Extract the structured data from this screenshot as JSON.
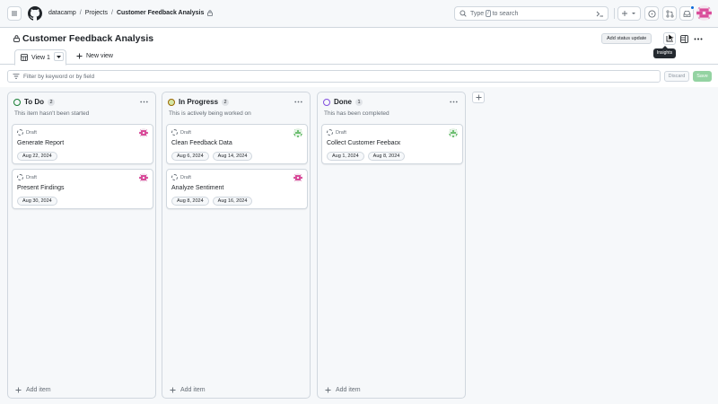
{
  "header": {
    "breadcrumbs": [
      "datacamp",
      "Projects",
      "Customer Feedback Analysis"
    ],
    "search": {
      "pre": "Type",
      "key": "/",
      "post": "to search"
    }
  },
  "project": {
    "title": "Customer Feedback Analysis",
    "status_button": "Add status update",
    "tooltip": "Insights"
  },
  "tabs": {
    "view": "View 1",
    "new_view": "New view"
  },
  "filter": {
    "placeholder": "Filter by keyword or by field",
    "discard": "Discard",
    "save": "Save"
  },
  "columns": [
    {
      "name": "To Do",
      "count": "2",
      "description": "This item hasn't been started",
      "color": "#1a7f37",
      "cards": [
        {
          "status": "Draft",
          "title": "Generate Report",
          "dates": [
            "Aug 22, 2024"
          ]
        },
        {
          "status": "Draft",
          "title": "Present Findings",
          "dates": [
            "Aug 30, 2024"
          ]
        }
      ],
      "add_item": "Add item"
    },
    {
      "name": "In Progress",
      "count": "2",
      "description": "This is actively being worked on",
      "color": "#9a6700",
      "cards": [
        {
          "status": "Draft",
          "title": "Clean Feedback Data",
          "dates": [
            "Aug 6, 2024",
            "Aug 14, 2024"
          ]
        },
        {
          "status": "Draft",
          "title": "Analyze Sentiment",
          "dates": [
            "Aug 8, 2024",
            "Aug 16, 2024"
          ]
        }
      ],
      "add_item": "Add item"
    },
    {
      "name": "Done",
      "count": "1",
      "description": "This has been completed",
      "color": "#8250df",
      "cards": [
        {
          "status": "Draft",
          "title": "Collect Customer Feebacк",
          "dates": [
            "Aug 1, 2024",
            "Aug 8, 2024"
          ]
        }
      ],
      "add_item": "Add item"
    }
  ],
  "colors": {
    "accent": "#1f883d",
    "todo": "#1a7f37",
    "in_progress": "#9a6700",
    "done": "#8250df",
    "avatar_pink": "#d94c9a",
    "avatar_green": "#6fbf73"
  }
}
